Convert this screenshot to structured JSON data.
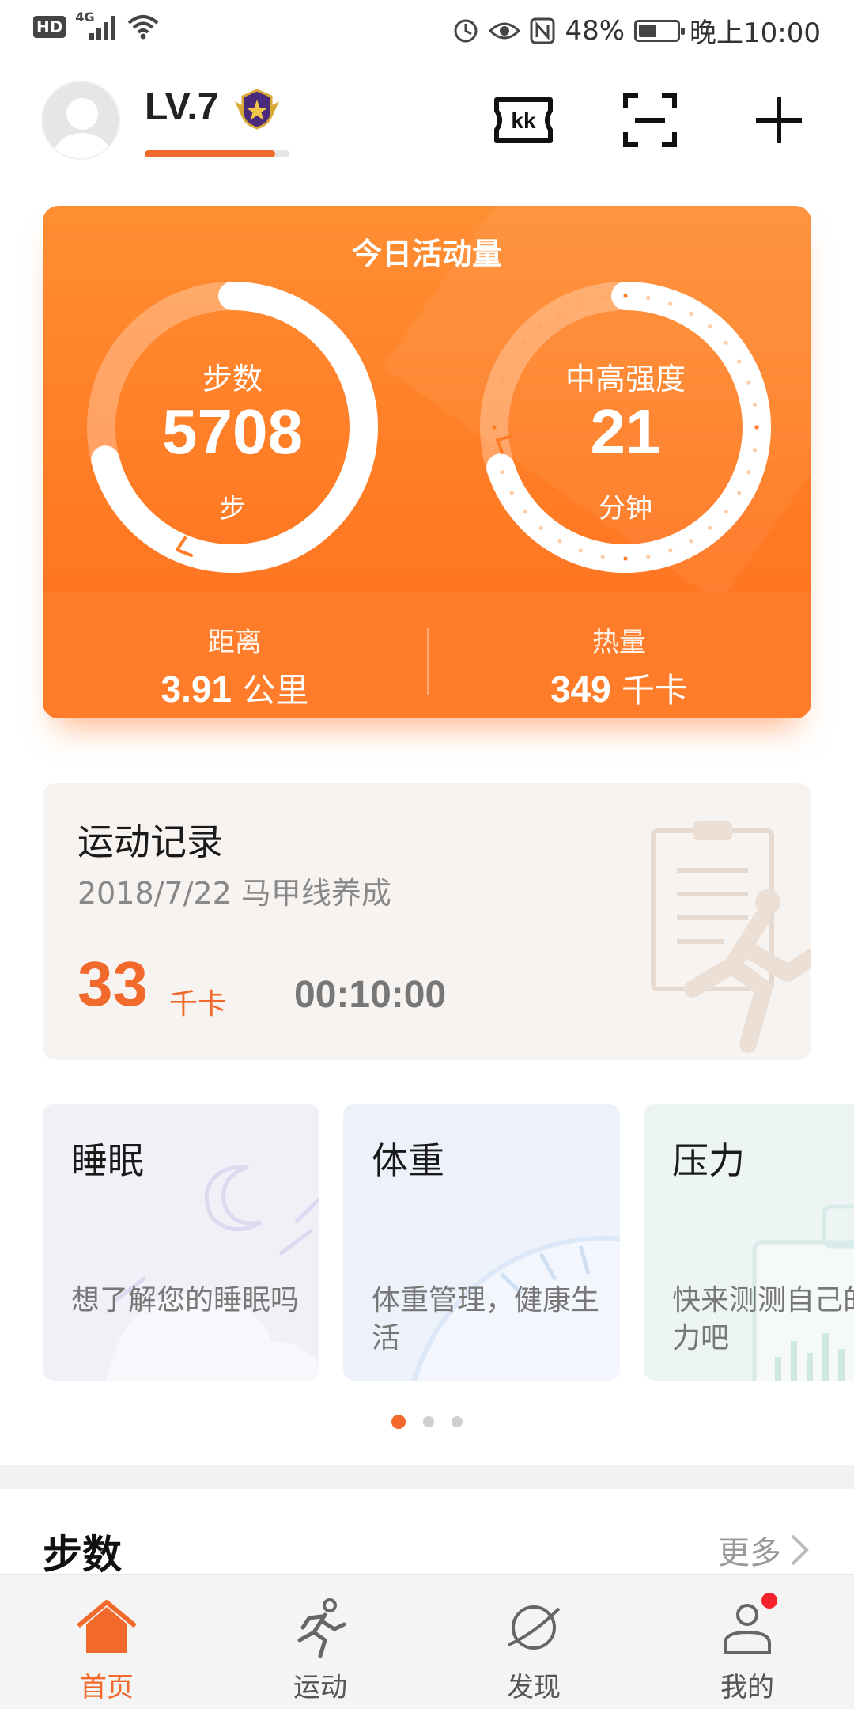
{
  "status_bar": {
    "hd": "HD",
    "network": "4G",
    "battery_percent": "48%",
    "battery_level": 0.48,
    "time": "晚上10:00"
  },
  "header": {
    "level": "LV.7",
    "level_progress": 0.9,
    "avatar": "avatar-icon",
    "icons": [
      "rank-badge-icon",
      "kk-ticket-icon",
      "scan-icon",
      "plus-icon"
    ]
  },
  "activity": {
    "title": "今日活动量",
    "steps": {
      "label": "步数",
      "value": "5708",
      "unit": "步",
      "progress": 0.71
    },
    "intensity": {
      "label": "中高强度",
      "value": "21",
      "unit": "分钟",
      "progress": 0.7
    },
    "distance": {
      "label": "距离",
      "value": "3.91",
      "unit": "公里"
    },
    "calories": {
      "label": "热量",
      "value": "349",
      "unit": "千卡"
    }
  },
  "record": {
    "title": "运动记录",
    "subtitle": "2018/7/22  马甲线养成",
    "calories": "33",
    "calories_unit": "千卡",
    "duration": "00:10:00"
  },
  "mini_cards": [
    {
      "title": "睡眠",
      "desc": "想了解您的睡眠吗",
      "bg": "#f1f0f6"
    },
    {
      "title": "体重",
      "desc": "体重管理，健康生活",
      "bg": "#edf2fa"
    },
    {
      "title": "压力",
      "desc": "快来测测自己的压力吧",
      "bg": "#edf5f4"
    }
  ],
  "pager": {
    "count": 3,
    "active": 0
  },
  "steps_section": {
    "title": "步数",
    "more": "更多"
  },
  "bottom_nav": [
    {
      "label": "首页",
      "icon": "home-icon",
      "active": true
    },
    {
      "label": "运动",
      "icon": "run-icon",
      "active": false
    },
    {
      "label": "发现",
      "icon": "discover-icon",
      "active": false
    },
    {
      "label": "我的",
      "icon": "profile-icon",
      "active": false,
      "badge": true
    }
  ],
  "colors": {
    "accent": "#f26a2b",
    "card_orange": "#ff7c25",
    "notification": "#f5222d"
  }
}
